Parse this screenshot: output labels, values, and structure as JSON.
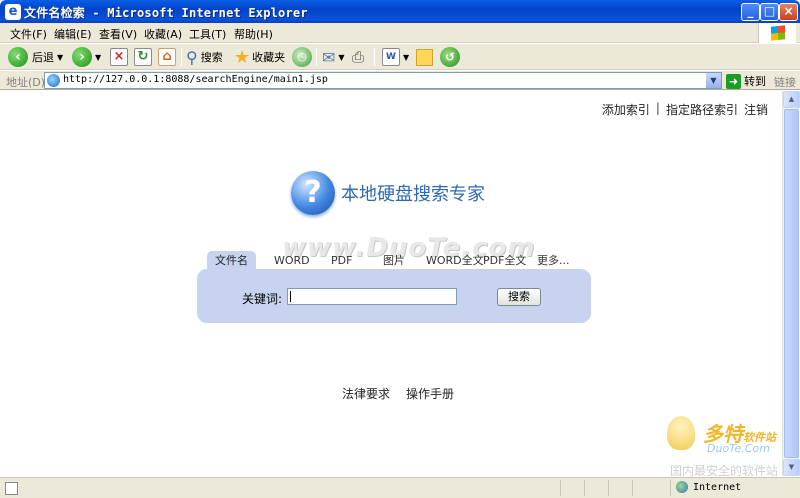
{
  "window": {
    "title": "文件名检索 - Microsoft Internet Explorer",
    "minimize": "_",
    "maximize": "□",
    "close": "×"
  },
  "menu": [
    "文件(F)",
    "编辑(E)",
    "查看(V)",
    "收藏(A)",
    "工具(T)",
    "帮助(H)"
  ],
  "toolbar": {
    "back_label": "后退",
    "search_label": "搜索",
    "favorites_label": "收藏夹"
  },
  "address": {
    "label": "地址(D)",
    "url": "http://127.0.0.1:8088/searchEngine/main1.jsp",
    "go_label": "转到",
    "links_label": "链接"
  },
  "page": {
    "top_links": {
      "add_index": "添加索引",
      "separator": "|",
      "path_index": "指定路径索引",
      "logout": "注销"
    },
    "logo_text": "本地硬盘搜索专家",
    "watermark": "www.DuoTe.com",
    "tabs": [
      "文件名",
      "WORD",
      "PDF",
      "图片",
      "WORD全文",
      "PDF全文",
      "更多..."
    ],
    "active_tab": "文件名",
    "keyword_label": "关键词:",
    "keyword_value": "",
    "search_button": "搜索",
    "footer_links": {
      "legal": "法律要求",
      "manual": "操作手册"
    },
    "corner_logo": {
      "brand": "多特",
      "brand_suffix": "软件站",
      "site": "DuoTe.Com",
      "slogan": "国内最安全的软件站"
    }
  },
  "status": {
    "zone": "Internet"
  }
}
